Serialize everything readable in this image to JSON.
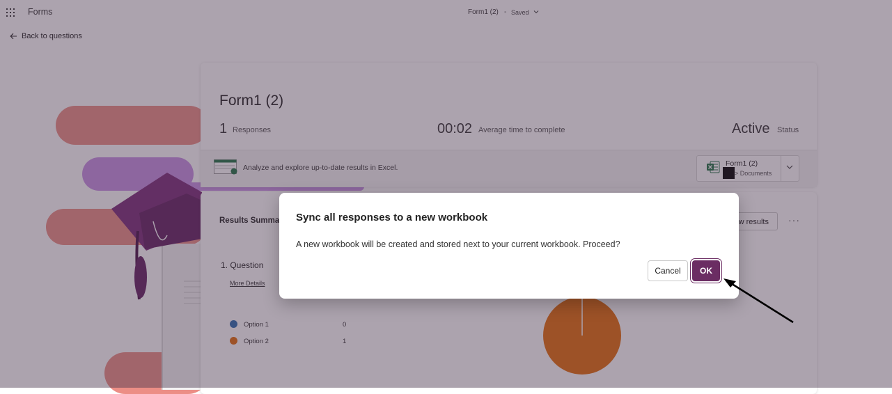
{
  "topbar": {
    "app_name": "Forms",
    "doc_title": "Form1 (2)",
    "separator": "-",
    "save_status": "Saved"
  },
  "nav": {
    "back_label": "Back to questions"
  },
  "summary": {
    "form_title": "Form1 (2)",
    "responses_count": "1",
    "responses_label": "Responses",
    "avg_time": "00:02",
    "avg_time_label": "Average time to complete",
    "status_value": "Active",
    "status_label": "Status"
  },
  "excel": {
    "prompt": "Analyze and explore up-to-date results in Excel.",
    "workbook_name": "Form1 (2)",
    "workbook_path": "> Documents"
  },
  "results": {
    "title": "Results Summa",
    "view_results_label": "w results",
    "more_options": "···",
    "question_title": "1. Question",
    "more_details": "More Details",
    "options": [
      {
        "label": "Option 1",
        "count": "0",
        "color": "#2b6cb0"
      },
      {
        "label": "Option 2",
        "count": "1",
        "color": "#e36c0a"
      }
    ]
  },
  "dialog": {
    "title": "Sync all responses to a new workbook",
    "message": "A new workbook will be created and stored next to your current workbook. Proceed?",
    "cancel_label": "Cancel",
    "ok_label": "OK",
    "accent_color": "#6b2d63"
  },
  "icons": [
    "waffle-icon",
    "chevron-down-icon",
    "back-arrow-icon",
    "excel-icon",
    "pointer-arrow"
  ]
}
